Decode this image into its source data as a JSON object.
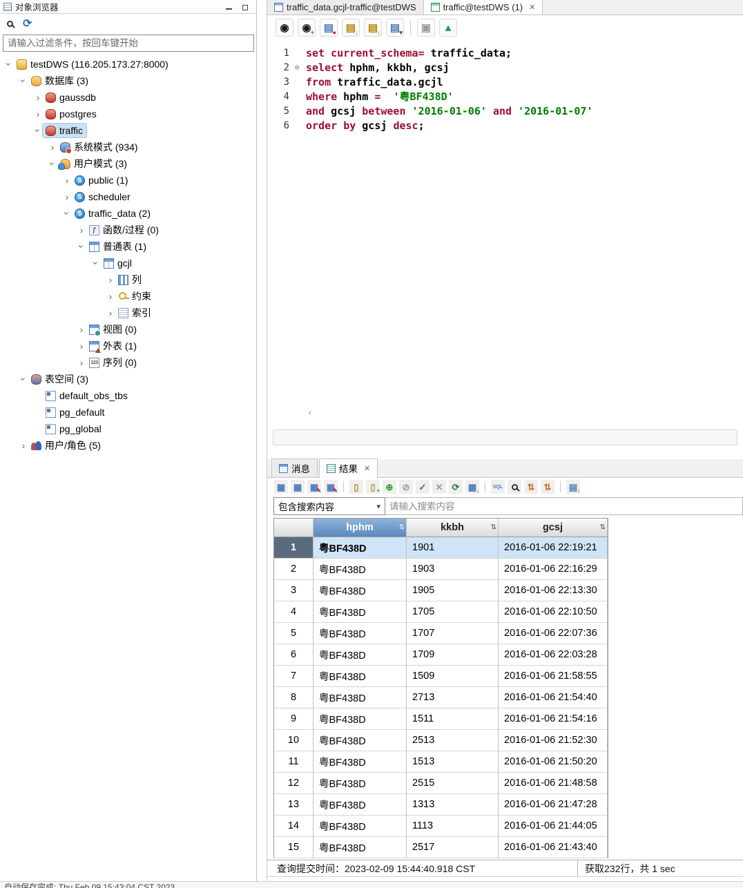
{
  "window": {
    "bottom_status": "自动保存完成: Thu Feb 09 15:43:04 CST 2023"
  },
  "object_browser": {
    "title": "对象浏览器",
    "filter_placeholder": "请输入过滤条件，按回车键开始",
    "tree": [
      {
        "id": "testdws",
        "level": 0,
        "expand": true,
        "icon": "server-db-icon",
        "label": "testDWS (116.205.173.27:8000)"
      },
      {
        "id": "databases",
        "level": 1,
        "expand": true,
        "icon": "database-group-icon",
        "label": "数据库 (3)"
      },
      {
        "id": "gaussdb",
        "level": 2,
        "expand": false,
        "icon": "database-icon",
        "label": "gaussdb"
      },
      {
        "id": "postgres",
        "level": 2,
        "expand": false,
        "icon": "database-icon",
        "label": "postgres"
      },
      {
        "id": "traffic",
        "level": 2,
        "expand": true,
        "icon": "database-icon",
        "label": "traffic",
        "selected": true
      },
      {
        "id": "system-schemas",
        "level": 3,
        "expand": false,
        "icon": "system-schema-icon",
        "label": "系统模式 (934)"
      },
      {
        "id": "user-schemas",
        "level": 3,
        "expand": true,
        "icon": "user-schema-icon",
        "label": "用户模式 (3)"
      },
      {
        "id": "public",
        "level": 4,
        "expand": false,
        "icon": "schema-icon",
        "label": "public (1)"
      },
      {
        "id": "scheduler",
        "level": 4,
        "expand": false,
        "icon": "schema-icon",
        "label": "scheduler"
      },
      {
        "id": "traffic-data",
        "level": 4,
        "expand": true,
        "icon": "schema-icon",
        "label": "traffic_data (2)"
      },
      {
        "id": "functions",
        "level": 5,
        "expand": false,
        "icon": "function-icon",
        "label": "函数/过程 (0)"
      },
      {
        "id": "ordinary-tables",
        "level": 5,
        "expand": true,
        "icon": "tables-icon",
        "label": "普通表 (1)"
      },
      {
        "id": "gcjl",
        "level": 6,
        "expand": true,
        "icon": "table-icon",
        "label": "gcjl"
      },
      {
        "id": "columns",
        "level": 7,
        "expand": false,
        "icon": "columns-icon",
        "label": "列"
      },
      {
        "id": "constraints",
        "level": 7,
        "expand": false,
        "icon": "constraint-icon",
        "label": "约束"
      },
      {
        "id": "indexes",
        "level": 7,
        "expand": false,
        "icon": "index-icon",
        "label": "索引"
      },
      {
        "id": "views",
        "level": 5,
        "expand": false,
        "icon": "view-icon",
        "label": "视图 (0)"
      },
      {
        "id": "foreign-tables",
        "level": 5,
        "expand": false,
        "icon": "foreign-table-icon",
        "label": "外表 (1)"
      },
      {
        "id": "sequences",
        "level": 5,
        "expand": false,
        "icon": "sequence-icon",
        "label": "序列 (0)"
      },
      {
        "id": "tablespaces",
        "level": 1,
        "expand": true,
        "icon": "tablespace-icon",
        "label": "表空间 (3)"
      },
      {
        "id": "default-obs-tbs",
        "level": 2,
        "expand": null,
        "icon": "tablespace-item-icon",
        "label": "default_obs_tbs"
      },
      {
        "id": "pg-default",
        "level": 2,
        "expand": null,
        "icon": "tablespace-item-icon",
        "label": "pg_default"
      },
      {
        "id": "pg-global",
        "level": 2,
        "expand": null,
        "icon": "tablespace-item-icon",
        "label": "pg_global"
      },
      {
        "id": "users-roles",
        "level": 1,
        "expand": false,
        "icon": "users-icon",
        "label": "用户/角色 (5)"
      }
    ]
  },
  "editor": {
    "tabs": [
      {
        "label": "traffic_data.gcjl-traffic@testDWS",
        "active": false,
        "closable": false
      },
      {
        "label": "traffic@testDWS (1)",
        "active": true,
        "closable": true
      }
    ],
    "toolbar": [
      {
        "name": "execute-button"
      },
      {
        "name": "execute-new-tab-button"
      },
      {
        "name": "save-query-button"
      },
      {
        "name": "export-result-button"
      },
      {
        "name": "export-all-button"
      },
      {
        "name": "templates-dropdown-button"
      },
      {
        "name": "separator"
      },
      {
        "name": "reuse-connection-button"
      },
      {
        "name": "visual-explain-button"
      }
    ],
    "sql_lines": [
      {
        "num": "1",
        "fold": false,
        "tokens": [
          [
            "kw",
            "set"
          ],
          [
            "pl",
            " "
          ],
          [
            "kw",
            "current_schema="
          ],
          [
            "pl",
            " traffic_data;"
          ]
        ]
      },
      {
        "num": "2",
        "fold": true,
        "tokens": [
          [
            "kw",
            "select"
          ],
          [
            "pl",
            " hphm, kkbh, gcsj"
          ]
        ]
      },
      {
        "num": "3",
        "fold": false,
        "tokens": [
          [
            "kw",
            "from"
          ],
          [
            "pl",
            " traffic_data.gcjl"
          ]
        ]
      },
      {
        "num": "4",
        "fold": false,
        "tokens": [
          [
            "kw",
            "where"
          ],
          [
            "pl",
            " hphm "
          ],
          [
            "kw",
            "="
          ],
          [
            "pl",
            "  "
          ],
          [
            "str",
            "'粤BF438D'"
          ]
        ]
      },
      {
        "num": "5",
        "fold": false,
        "tokens": [
          [
            "kw",
            "and"
          ],
          [
            "pl",
            " gcsj "
          ],
          [
            "kw",
            "between"
          ],
          [
            "pl",
            " "
          ],
          [
            "str",
            "'2016-01-06'"
          ],
          [
            "pl",
            " "
          ],
          [
            "kw",
            "and"
          ],
          [
            "pl",
            " "
          ],
          [
            "str",
            "'2016-01-07'"
          ]
        ]
      },
      {
        "num": "6",
        "fold": false,
        "tokens": [
          [
            "kw",
            "order"
          ],
          [
            "pl",
            " "
          ],
          [
            "kw",
            "by"
          ],
          [
            "pl",
            " gcsj "
          ],
          [
            "kw",
            "desc"
          ],
          [
            "pl",
            ";"
          ]
        ]
      }
    ]
  },
  "results_panel": {
    "tabs": [
      {
        "label": "消息",
        "active": false
      },
      {
        "label": "结果",
        "active": true,
        "closable": true
      }
    ],
    "toolbar": [
      {
        "name": "copy-icon"
      },
      {
        "name": "copy-table-icon"
      },
      {
        "name": "edit-copy-icon"
      },
      {
        "name": "edit-paste-icon"
      },
      {
        "name": "separator"
      },
      {
        "name": "paste-icon"
      },
      {
        "name": "paste-append-icon"
      },
      {
        "name": "add-record-icon"
      },
      {
        "name": "delete-record-icon"
      },
      {
        "name": "commit-icon"
      },
      {
        "name": "rollback-icon"
      },
      {
        "name": "refresh-grid-icon"
      },
      {
        "name": "export-grid-icon"
      },
      {
        "name": "separator"
      },
      {
        "name": "show-sql-icon"
      },
      {
        "name": "search-grid-icon"
      },
      {
        "name": "expand-rows-icon"
      },
      {
        "name": "collapse-rows-icon"
      },
      {
        "name": "separator"
      },
      {
        "name": "export-data-icon"
      }
    ],
    "search": {
      "scope_dropdown": "包含搜索内容",
      "input_placeholder": "请输入搜索内容"
    },
    "grid": {
      "columns": [
        "hphm",
        "kkbh",
        "gcsj"
      ],
      "selected_column": "hphm",
      "rows": [
        {
          "num": "1",
          "selected": true,
          "cells": [
            "粤BF438D",
            "1901",
            "2016-01-06 22:19:21"
          ]
        },
        {
          "num": "2",
          "cells": [
            "粤BF438D",
            "1903",
            "2016-01-06 22:16:29"
          ]
        },
        {
          "num": "3",
          "cells": [
            "粤BF438D",
            "1905",
            "2016-01-06 22:13:30"
          ]
        },
        {
          "num": "4",
          "cells": [
            "粤BF438D",
            "1705",
            "2016-01-06 22:10:50"
          ]
        },
        {
          "num": "5",
          "cells": [
            "粤BF438D",
            "1707",
            "2016-01-06 22:07:36"
          ]
        },
        {
          "num": "6",
          "cells": [
            "粤BF438D",
            "1709",
            "2016-01-06 22:03:28"
          ]
        },
        {
          "num": "7",
          "cells": [
            "粤BF438D",
            "1509",
            "2016-01-06 21:58:55"
          ]
        },
        {
          "num": "8",
          "cells": [
            "粤BF438D",
            "2713",
            "2016-01-06 21:54:40"
          ]
        },
        {
          "num": "9",
          "cells": [
            "粤BF438D",
            "1511",
            "2016-01-06 21:54:16"
          ]
        },
        {
          "num": "10",
          "cells": [
            "粤BF438D",
            "2513",
            "2016-01-06 21:52:30"
          ]
        },
        {
          "num": "11",
          "cells": [
            "粤BF438D",
            "1513",
            "2016-01-06 21:50:20"
          ]
        },
        {
          "num": "12",
          "cells": [
            "粤BF438D",
            "2515",
            "2016-01-06 21:48:58"
          ]
        },
        {
          "num": "13",
          "cells": [
            "粤BF438D",
            "1313",
            "2016-01-06 21:47:28"
          ]
        },
        {
          "num": "14",
          "cells": [
            "粤BF438D",
            "1113",
            "2016-01-06 21:44:05"
          ]
        },
        {
          "num": "15",
          "cells": [
            "粤BF438D",
            "2517",
            "2016-01-06 21:43:40"
          ]
        }
      ]
    },
    "status": {
      "left": "查询提交时间：2023-02-09 15:44:40.918 CST",
      "right": "获取232行，共 1 sec"
    }
  }
}
